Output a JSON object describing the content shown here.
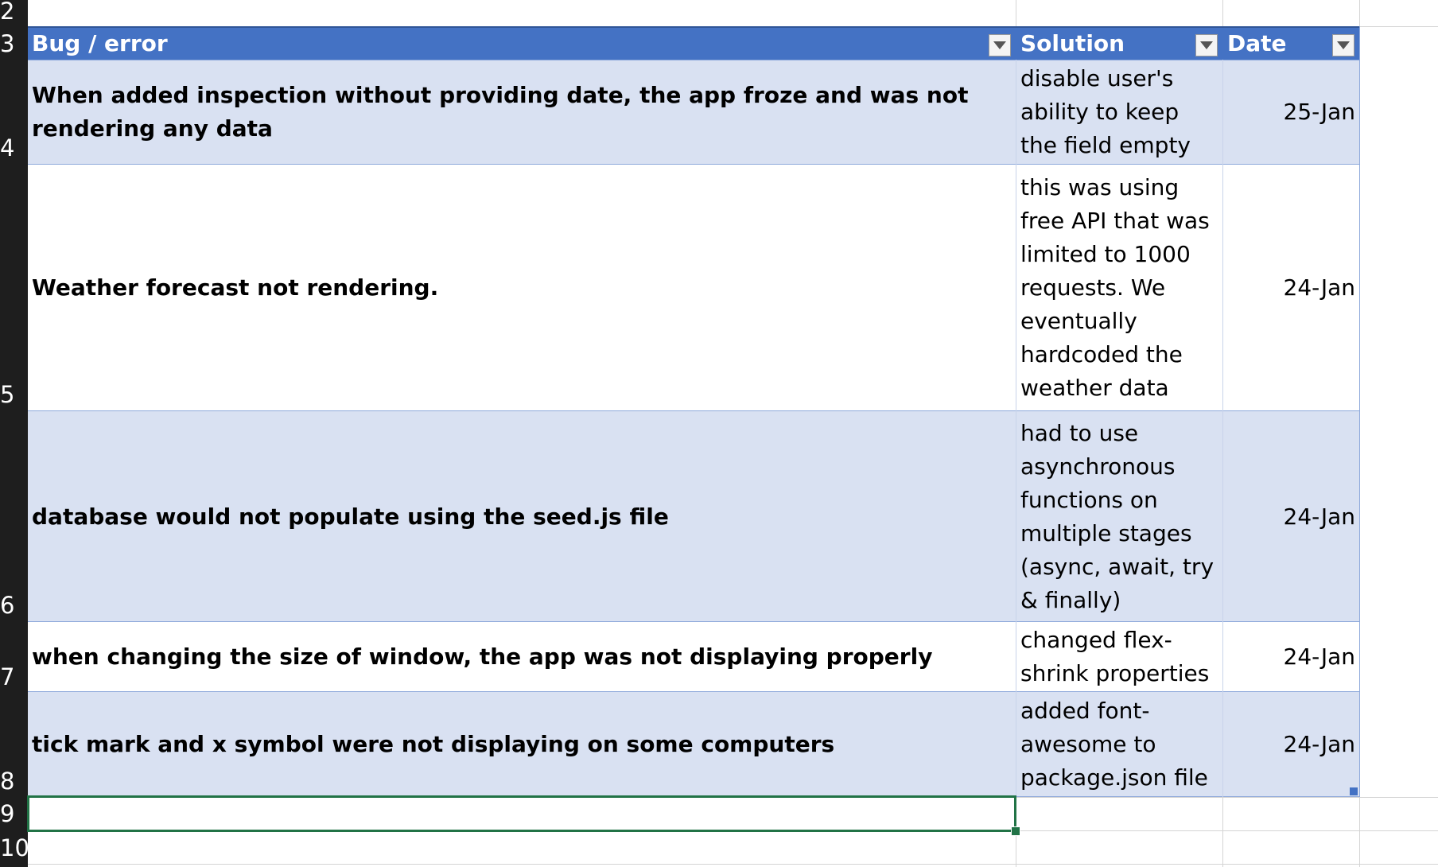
{
  "row_numbers": [
    "2",
    "3",
    "4",
    "5",
    "6",
    "7",
    "8",
    "9",
    "10"
  ],
  "table": {
    "headers": [
      "Bug / error",
      "Solution",
      "Date"
    ],
    "rows": [
      {
        "bug": "When added inspection without providing date, the app froze and was not rendering any data",
        "solution": "disable user's ability to keep the field empty",
        "date": "25-Jan"
      },
      {
        "bug": "Weather forecast not rendering.",
        "solution": "this was using free API that was limited to 1000 requests. We eventually hardcoded the weather data",
        "date": "24-Jan"
      },
      {
        "bug": "database would not populate using the seed.js file",
        "solution": "had to use asynchronous functions on multiple stages (async, await, try & finally)",
        "date": "24-Jan"
      },
      {
        "bug": "when changing the size of window, the app was not displaying properly",
        "solution": "changed flex-shrink properties",
        "date": "24-Jan"
      },
      {
        "bug": "tick mark and x symbol were not displaying on some computers",
        "solution": "added font-awesome to package.json file",
        "date": "24-Jan"
      }
    ]
  },
  "colors": {
    "header_bg": "#4472c4",
    "band_bg": "#d9e1f2",
    "selection": "#217346",
    "row_header_bg": "#1e1e1e"
  },
  "icons": {
    "filter": "filter-dropdown-icon"
  }
}
